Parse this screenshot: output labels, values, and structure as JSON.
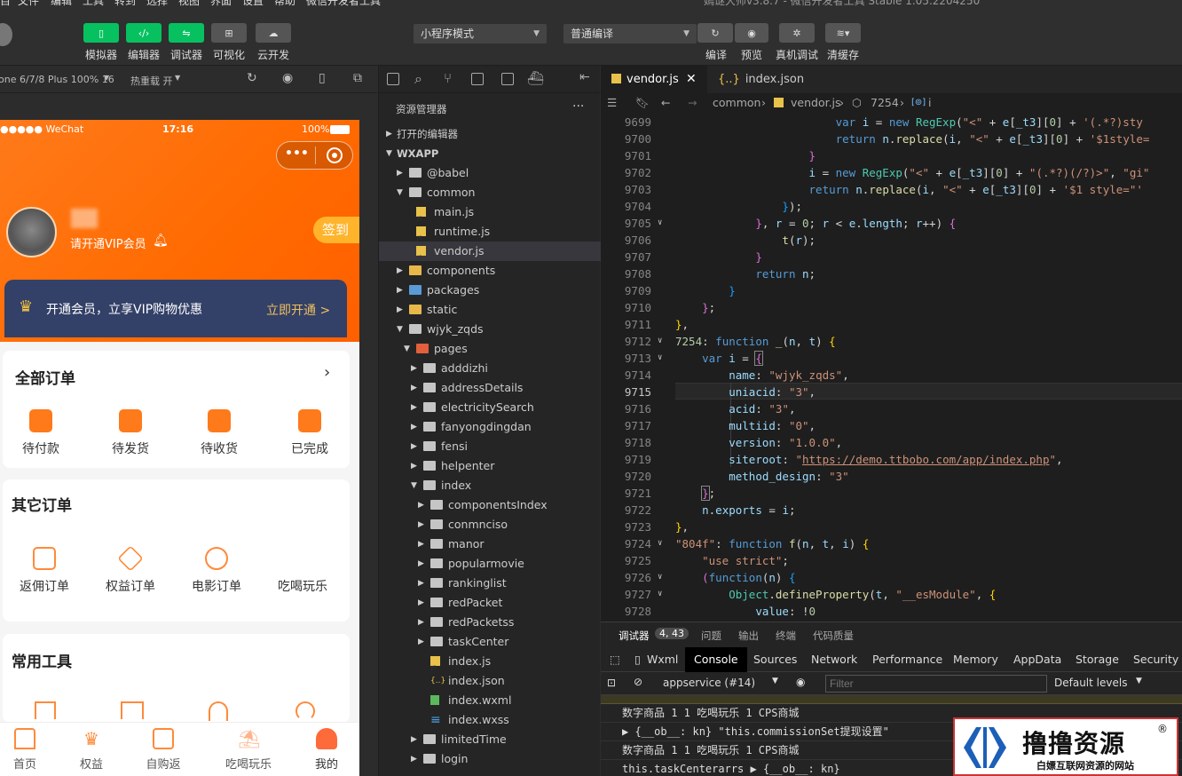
{
  "menubar": {
    "items": [
      "目",
      "文件",
      "编辑",
      "工具",
      "转到",
      "选择",
      "视图",
      "界面",
      "设置",
      "帮助",
      "微信开发者工具"
    ],
    "window_title": "嫣谜大师v3.8.7 - 微信开发者工具 Stable 1.05.2204250"
  },
  "toolbar": {
    "buttons": [
      {
        "label": "模拟器"
      },
      {
        "label": "编辑器"
      },
      {
        "label": "调试器"
      },
      {
        "label": "可视化"
      },
      {
        "label": "云开发"
      }
    ],
    "mode_select": "小程序模式",
    "compile_select": "普通编译",
    "actions": [
      {
        "label": "编译"
      },
      {
        "label": "预览"
      },
      {
        "label": "真机调试"
      },
      {
        "label": "清缓存"
      }
    ]
  },
  "simulator": {
    "device": "one 6/7/8 Plus 100% 16",
    "hot_reload": "热重载 开",
    "status": {
      "carrier": "●●●●● WeChat",
      "time": "17:16",
      "battery": "100%"
    },
    "user": {
      "vip_label": "请开通VIP会员",
      "signin": "签到"
    },
    "vip_card": {
      "text": "开通会员，立享VIP购物优惠",
      "action": "立即开通 >"
    },
    "orders": {
      "title": "全部订单",
      "items": [
        "待付款",
        "待发货",
        "待收货",
        "已完成"
      ]
    },
    "other_orders": {
      "title": "其它订单",
      "items": [
        "返佣订单",
        "权益订单",
        "电影订单",
        "吃喝玩乐"
      ]
    },
    "tools": {
      "title": "常用工具"
    },
    "tabs": [
      "首页",
      "权益",
      "自购返",
      "吃喝玩乐",
      "我的"
    ],
    "colors": {
      "primary": "#ff6a00",
      "vip_card": "#334067"
    }
  },
  "explorer": {
    "title": "资源管理器",
    "open_editors": "打开的编辑器",
    "root": "WXAPP",
    "tree": [
      {
        "name": "@babel",
        "depth": 1,
        "type": "folder",
        "arrow": "▶"
      },
      {
        "name": "common",
        "depth": 1,
        "type": "folder",
        "arrow": "▼"
      },
      {
        "name": "main.js",
        "depth": 2,
        "type": "js"
      },
      {
        "name": "runtime.js",
        "depth": 2,
        "type": "js"
      },
      {
        "name": "vendor.js",
        "depth": 2,
        "type": "js",
        "selected": true
      },
      {
        "name": "components",
        "depth": 1,
        "type": "folder-y",
        "arrow": "▶"
      },
      {
        "name": "packages",
        "depth": 1,
        "type": "folder-b",
        "arrow": "▶"
      },
      {
        "name": "static",
        "depth": 1,
        "type": "folder-y",
        "arrow": "▶"
      },
      {
        "name": "wjyk_zqds",
        "depth": 1,
        "type": "folder",
        "arrow": "▼"
      },
      {
        "name": "pages",
        "depth": 2,
        "type": "folder-r",
        "arrow": "▼"
      },
      {
        "name": "adddizhi",
        "depth": 3,
        "type": "folder",
        "arrow": "▶"
      },
      {
        "name": "addressDetails",
        "depth": 3,
        "type": "folder",
        "arrow": "▶"
      },
      {
        "name": "electricitySearch",
        "depth": 3,
        "type": "folder",
        "arrow": "▶"
      },
      {
        "name": "fanyongdingdan",
        "depth": 3,
        "type": "folder",
        "arrow": "▶"
      },
      {
        "name": "fensi",
        "depth": 3,
        "type": "folder",
        "arrow": "▶"
      },
      {
        "name": "helpenter",
        "depth": 3,
        "type": "folder",
        "arrow": "▶"
      },
      {
        "name": "index",
        "depth": 3,
        "type": "folder",
        "arrow": "▼"
      },
      {
        "name": "componentsIndex",
        "depth": 4,
        "type": "folder",
        "arrow": "▶"
      },
      {
        "name": "conmnciso",
        "depth": 4,
        "type": "folder",
        "arrow": "▶"
      },
      {
        "name": "manor",
        "depth": 4,
        "type": "folder",
        "arrow": "▶"
      },
      {
        "name": "popularmovie",
        "depth": 4,
        "type": "folder",
        "arrow": "▶"
      },
      {
        "name": "rankinglist",
        "depth": 4,
        "type": "folder",
        "arrow": "▶"
      },
      {
        "name": "redPacket",
        "depth": 4,
        "type": "folder",
        "arrow": "▶"
      },
      {
        "name": "redPacketss",
        "depth": 4,
        "type": "folder",
        "arrow": "▶"
      },
      {
        "name": "taskCenter",
        "depth": 4,
        "type": "folder",
        "arrow": "▶"
      },
      {
        "name": "index.js",
        "depth": 4,
        "type": "js"
      },
      {
        "name": "index.json",
        "depth": 4,
        "type": "json"
      },
      {
        "name": "index.wxml",
        "depth": 4,
        "type": "wxml"
      },
      {
        "name": "index.wxss",
        "depth": 4,
        "type": "wxss"
      },
      {
        "name": "limitedTime",
        "depth": 3,
        "type": "folder",
        "arrow": "▶"
      },
      {
        "name": "login",
        "depth": 3,
        "type": "folder",
        "arrow": "▶"
      }
    ]
  },
  "editor": {
    "tabs": [
      {
        "name": "vendor.js",
        "active": true
      },
      {
        "name": "index.json",
        "active": false
      }
    ],
    "breadcrumb": [
      "common",
      "vendor.js",
      "7254",
      "i"
    ],
    "current_line": "9715"
  },
  "panel": {
    "tabs": [
      "调试器",
      "问题",
      "输出",
      "终端",
      "代码质量"
    ],
    "badge": "4, 43",
    "devtools_tabs": [
      "Wxml",
      "Console",
      "Sources",
      "Network",
      "Performance",
      "Memory",
      "AppData",
      "Storage",
      "Security"
    ],
    "context": "appservice (#14)",
    "filter_placeholder": "Filter",
    "levels": "Default levels",
    "console_lines": [
      "数字商品 1 1 吃喝玩乐 1 CPS商城",
      "▶ {__ob__: kn} \"this.commissionSet提现设置\"",
      "数字商品 1 1 吃喝玩乐 1 CPS商城",
      "this.taskCenterarrs ▶ {__ob__: kn}"
    ]
  },
  "watermark": {
    "title": "撸撸资源",
    "subtitle": "白嫖互联网资源的网站"
  }
}
